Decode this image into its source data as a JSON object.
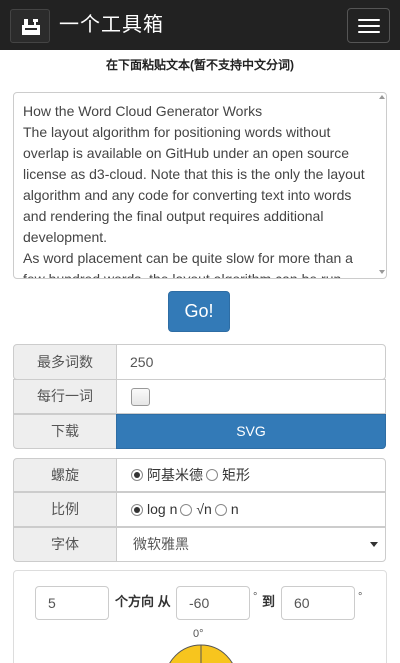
{
  "header": {
    "title": "一个工具箱",
    "logo_icon": "toolbox-logo-icon",
    "menu_icon": "hamburger-menu-icon"
  },
  "instruction": "在下面粘贴文本(暂不支持中文分词)",
  "text_input": {
    "value": "How the Word Cloud Generator Works\nThe layout algorithm for positioning words without overlap is available on GitHub under an open source license as d3-cloud. Note that this is the only the layout algorithm and any code for converting text into words and rendering the final output requires additional development.\nAs word placement can be quite slow for more than a few hundred words, the layout algorithm can be run asynchronously, with a configurable time step size."
  },
  "go_button": "Go!",
  "options": {
    "max_words_label": "最多词数",
    "max_words_value": "250",
    "one_per_line_label": "每行一词",
    "one_per_line_checked": false,
    "download_label": "下载",
    "download_button": "SVG",
    "spiral_label": "螺旋",
    "spiral_options": [
      "阿基米德",
      "矩形"
    ],
    "spiral_selected": 0,
    "scale_label": "比例",
    "scale_options": [
      "log n",
      "√n",
      "n"
    ],
    "scale_selected": 0,
    "font_label": "字体",
    "font_value": "微软雅黑"
  },
  "orientation": {
    "count": "5",
    "count_suffix": "个方向 从",
    "from": "-60",
    "degree_mark": "°",
    "to_label": "到",
    "to": "60",
    "dial_label": "0°"
  },
  "colors": {
    "navbar": "#222222",
    "primary": "#337ab7",
    "dial_fill": "#f7c51e"
  }
}
